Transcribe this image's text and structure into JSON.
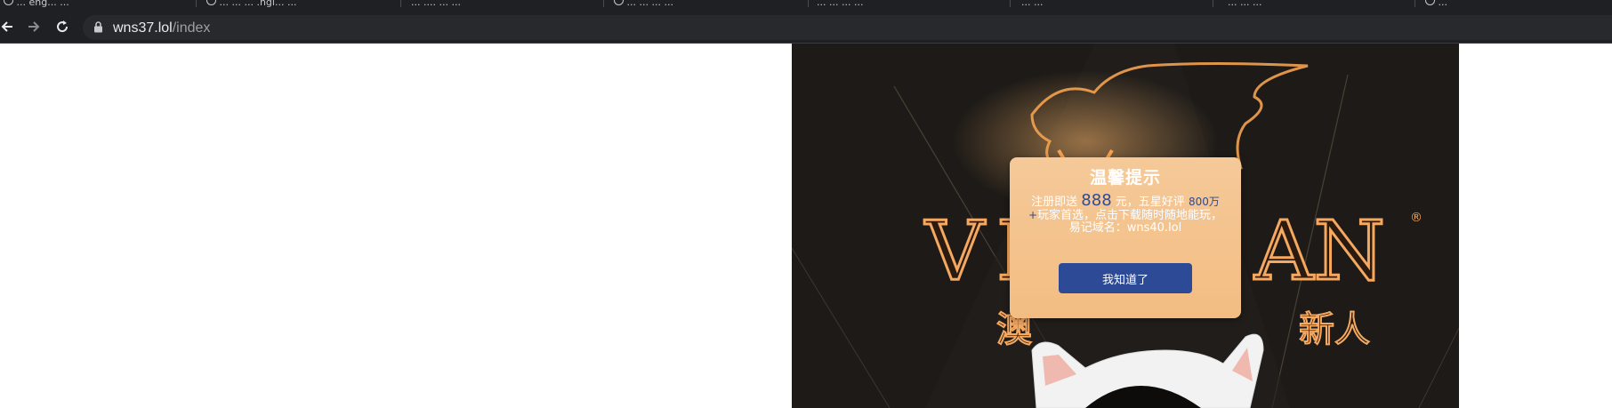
{
  "browser": {
    "tabs": [
      {
        "title": "... eng... ..."
      },
      {
        "title": "... ... ... .ngl... ..."
      },
      {
        "title": "... .... ... ..."
      },
      {
        "title": "... ... ... ..."
      },
      {
        "title": "... ... ... ..."
      },
      {
        "title": "... ..."
      },
      {
        "title": "... ... ..."
      },
      {
        "title": "..."
      }
    ],
    "url_host": "wns37.lol",
    "url_path": "/index"
  },
  "popup": {
    "title": "温馨提示",
    "msg_part1": "注册即送",
    "msg_amount": "888",
    "msg_part2": "元，五星好评",
    "msg_count": "800万+",
    "msg_part3": "玩家首选，点击下载随时随地能玩，易记域名：wns40.lol",
    "button_label": "我知道了"
  },
  "colors": {
    "popup_bg": "#f5c999",
    "button_bg": "#2d4a96",
    "highlight": "#2e4a96",
    "stage_bg": "#1d1a17"
  }
}
